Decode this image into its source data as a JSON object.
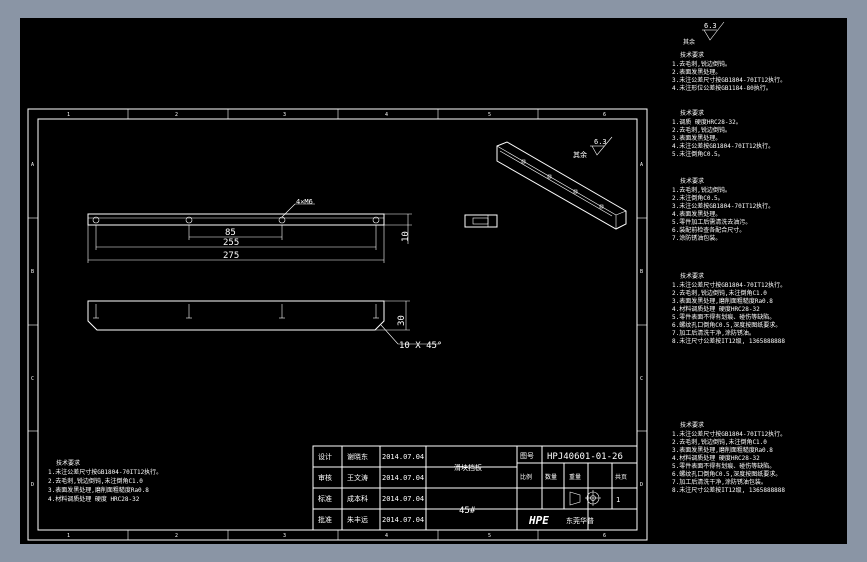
{
  "drawing": {
    "border_letters": [
      "A",
      "B",
      "C",
      "D"
    ],
    "border_numbers": [
      "1",
      "2",
      "3",
      "4",
      "5",
      "6"
    ],
    "surface_roughness": "6.3",
    "roughness_prefix": "其余",
    "dims": {
      "holes": "4×M6",
      "d85": "85",
      "d255": "255",
      "d275": "275",
      "thick": "10",
      "height": "30",
      "chamfer": "10 X 45°"
    },
    "tech_req": {
      "title": "技术要求",
      "lines": [
        "1.未注公差尺寸按GB1804-70IT12执行。",
        "2.去毛刺,锐边倒钝,未注倒角C1.0",
        "3.表面发黑处理,磨削面粗糙度Ra0.8",
        "4.材料调质处理 硬度 HRC28-32"
      ]
    },
    "side_notes": [
      {
        "title": "技术要求",
        "lines": [
          "1.去毛刺,锐边倒钝。",
          "2.表面发黑处理。",
          "3.未注公差尺寸按GB1804-70IT12执行。",
          "4.未注形位公差按GB1184-80执行。"
        ]
      },
      {
        "title": "技术要求",
        "lines": [
          "1.调质 硬度HRC28-32。",
          "2.去毛刺,锐边倒钝。",
          "3.表面发黑处理。",
          "4.未注公差按GB1804-70IT12执行。",
          "5.未注倒角C0.5。"
        ]
      },
      {
        "title": "技术要求",
        "lines": [
          "1.去毛刺,锐边倒钝。",
          "2.未注倒角C0.5。",
          "3.未注公差按GB1804-70IT12执行。",
          "4.表面发黑处理。",
          "5.零件加工后需清洗去油污。",
          "6.装配前检查各配合尺寸。",
          "7.涂防锈油包装。"
        ]
      },
      {
        "title": "技术要求",
        "lines": [
          "1.未注公差尺寸按GB1804-70IT12执行。",
          "2.去毛刺,锐边倒钝,未注倒角C1.0",
          "3.表面发黑处理,磨削面粗糙度Ra0.8",
          "4.材料调质处理 硬度HRC28-32",
          "5.零件表面不得有划痕、碰伤等缺陷。",
          "6.螺纹孔口倒角C0.5,深度按图纸要求。",
          "7.加工后清洗干净,涂防锈油。",
          "8.未注尺寸公差按IT12级, 1365888888"
        ]
      },
      {
        "title": "技术要求",
        "lines": [
          "1.未注公差尺寸按GB1804-70IT12执行。",
          "2.去毛刺,锐边倒钝,未注倒角C1.0",
          "3.表面发黑处理,磨削面粗糙度Ra0.8",
          "4.材料调质处理 硬度HRC28-32",
          "5.零件表面不得有划痕、碰伤等缺陷。",
          "6.螺纹孔口倒角C0.5,深度按图纸要求。",
          "7.加工后清洗干净,涂防锈油包装。",
          "8.未注尺寸公差按IT12级, 1365888888"
        ]
      }
    ],
    "title_block": {
      "roles": [
        "设计",
        "审核",
        "标准",
        "批准"
      ],
      "names": [
        "谢晓东",
        "王文涛",
        "成本科",
        "朱丰远"
      ],
      "dates": [
        "2014.07.04",
        "2014.07.04",
        "2014.07.04",
        "2014.07.04"
      ],
      "part_name": "滑块挡板",
      "material": "45#",
      "code_label": "图号",
      "drawing_no": "HPJ40601-01-26",
      "cols": [
        "比例",
        "数量",
        "重量",
        "共页"
      ],
      "sheet_count": "1",
      "logo": "HPE",
      "company": "东莞华普"
    }
  }
}
